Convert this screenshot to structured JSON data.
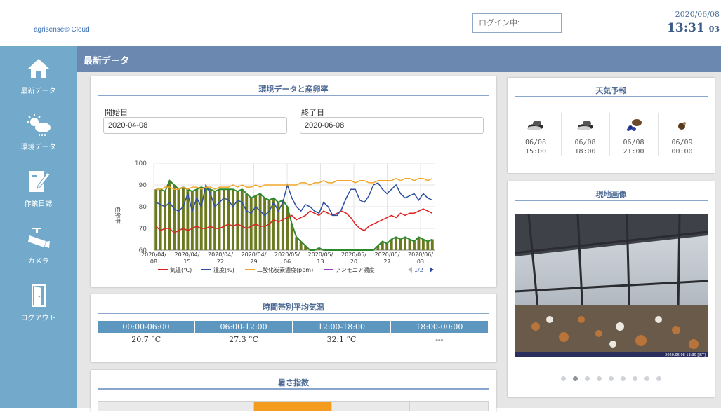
{
  "header": {
    "logo_text": "agrisense® Cloud",
    "login_placeholder": "ログイン中:",
    "date": "2020/06/08",
    "time": "13:31",
    "seconds": "03"
  },
  "sidebar": {
    "items": [
      {
        "label": "最新データ",
        "icon": "home-icon"
      },
      {
        "label": "環境データ",
        "icon": "weather-icon"
      },
      {
        "label": "作業日誌",
        "icon": "notebook-icon"
      },
      {
        "label": "カメラ",
        "icon": "camera-icon"
      },
      {
        "label": "ログアウト",
        "icon": "exit-door-icon"
      }
    ]
  },
  "page": {
    "title": "最新データ"
  },
  "env_panel": {
    "title": "環境データと産卵率",
    "start_label": "開始日",
    "start_value": "2020-04-08",
    "end_label": "終了日",
    "end_value": "2020-06-08",
    "pager": "1/2"
  },
  "chart_data": {
    "type": "line",
    "ylabel": "産卵率",
    "ylim": [
      60,
      100
    ],
    "yticks": [
      60,
      70,
      80,
      90,
      100
    ],
    "xtick_labels": [
      [
        "2020/04/",
        "08"
      ],
      [
        "2020/04/",
        "15"
      ],
      [
        "2020/04/",
        "22"
      ],
      [
        "2020/04/",
        "29"
      ],
      [
        "2020/05/",
        "06"
      ],
      [
        "2020/05/",
        "13"
      ],
      [
        "2020/05/",
        "20"
      ],
      [
        "2020/05/",
        "27"
      ],
      [
        "2020/06/",
        "03"
      ]
    ],
    "num_points": 62,
    "legend": [
      {
        "name": "気温(℃)",
        "color": "#e02020"
      },
      {
        "name": "湿度(%)",
        "color": "#2d4fa0"
      },
      {
        "name": "二酸化炭素濃度(ppm)",
        "color": "#f2a72a"
      },
      {
        "name": "アンモニア濃度",
        "color": "#9b3fb0"
      }
    ],
    "bar_color": "#6b7a1f",
    "egg_line_color": "#2c8a2c",
    "bars": [
      88,
      88,
      87,
      92,
      90,
      88,
      89,
      88,
      87,
      88,
      89,
      88,
      88,
      87,
      88,
      88,
      88,
      88,
      87,
      88,
      86,
      84,
      85,
      86,
      84,
      83,
      84,
      82,
      83,
      80,
      72,
      66,
      64,
      62,
      60,
      60,
      61,
      60,
      60,
      60,
      60,
      60,
      60,
      60,
      60,
      60,
      60,
      60,
      60,
      62,
      64,
      63,
      65,
      66,
      65,
      66,
      65,
      64,
      66,
      65,
      64,
      65
    ],
    "series": [
      {
        "name": "気温(℃)",
        "color": "#e02020",
        "values": [
          71,
          69,
          70,
          70,
          68,
          69,
          70,
          69,
          70,
          71,
          70,
          70,
          71,
          70,
          70,
          71,
          72,
          71,
          72,
          71,
          70,
          71,
          72,
          71,
          71,
          72,
          74,
          73,
          74,
          75,
          76,
          74,
          75,
          76,
          78,
          77,
          76,
          78,
          77,
          76,
          77,
          78,
          77,
          75,
          72,
          70,
          69,
          71,
          72,
          73,
          74,
          75,
          76,
          75,
          77,
          76,
          77,
          77,
          78,
          79,
          78,
          77
        ]
      },
      {
        "name": "湿度(%)",
        "color": "#2d4fa0",
        "values": [
          82,
          81,
          80,
          82,
          79,
          78,
          80,
          86,
          78,
          84,
          80,
          90,
          86,
          80,
          82,
          84,
          83,
          80,
          83,
          82,
          78,
          77,
          80,
          78,
          76,
          78,
          82,
          78,
          82,
          90,
          84,
          80,
          78,
          81,
          80,
          78,
          77,
          82,
          80,
          76,
          76,
          79,
          84,
          88,
          88,
          83,
          82,
          85,
          90,
          91,
          88,
          86,
          88,
          90,
          86,
          84,
          85,
          86,
          83,
          86,
          84,
          83
        ]
      },
      {
        "name": "二酸化炭素濃度(ppm)",
        "color": "#f2a72a",
        "values": [
          88,
          88,
          89,
          89,
          88,
          88,
          89,
          88,
          89,
          89,
          88,
          89,
          89,
          88,
          89,
          89,
          89,
          90,
          89,
          90,
          89,
          89,
          90,
          89,
          90,
          90,
          90,
          90,
          90,
          90,
          90,
          90,
          91,
          91,
          90,
          91,
          91,
          92,
          91,
          91,
          92,
          92,
          92,
          92,
          91,
          92,
          92,
          91,
          91,
          92,
          92,
          92,
          92,
          93,
          92,
          93,
          93,
          92,
          93,
          93,
          92,
          93
        ]
      }
    ]
  },
  "temp_panel": {
    "title": "時間帯別平均気温",
    "headers": [
      "00:00-06:00",
      "06:00-12:00",
      "12:00-18:00",
      "18:00-00:00"
    ],
    "values": [
      "20.7 °C",
      "27.3 °C",
      "32.1 °C",
      "---"
    ]
  },
  "heat_panel": {
    "title": "暑さ指数",
    "active_color": "#f39c1f"
  },
  "weather_panel": {
    "title": "天気予報",
    "forecasts": [
      {
        "date": "06/08",
        "time": "15:00",
        "icon": "cloud-icon"
      },
      {
        "date": "06/08",
        "time": "18:00",
        "icon": "cloud-icon"
      },
      {
        "date": "06/08",
        "time": "21:00",
        "icon": "rain-cloud-icon"
      },
      {
        "date": "06/09",
        "time": "00:00",
        "icon": "cloud-icon"
      }
    ]
  },
  "camera_panel": {
    "title": "現地画像",
    "image_timestamp": "2020.06.08 13:30 [JST]",
    "slide_count": 9,
    "active_slide": 2
  }
}
